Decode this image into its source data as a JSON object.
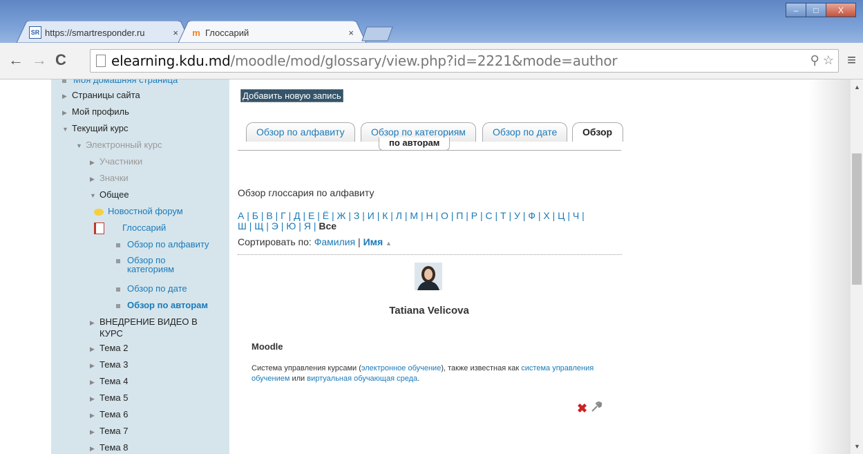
{
  "browser": {
    "tabs": [
      {
        "favicon": "SR",
        "title": "https://smartresponder.ru",
        "close": "×"
      },
      {
        "favicon": "moodle-icon",
        "title": "Глоссарий",
        "close": "×"
      }
    ],
    "url_domain": "elearning.kdu.md",
    "url_path": "/moodle/mod/glossary/view.php?id=2221&mode=author",
    "back": "←",
    "forward": "→",
    "reload": "C",
    "menu": "≡",
    "zoom_icon": "⚲",
    "star_icon": "☆",
    "window_controls": {
      "minimize": "–",
      "maximize": "□",
      "close": "X"
    }
  },
  "sidebar": {
    "items": [
      {
        "label": "Моя домашняя страница",
        "style": "blue-cut"
      },
      {
        "label": "Страницы сайта",
        "arrow": "▶"
      },
      {
        "label": "Мой профиль",
        "arrow": "▶"
      },
      {
        "label": "Текущий курс",
        "arrow": "▼"
      },
      {
        "label": "Электронный курс",
        "arrow": "▼",
        "style": "dim"
      },
      {
        "label": "Участники",
        "arrow": "▶",
        "style": "dim"
      },
      {
        "label": "Значки",
        "arrow": "▶",
        "style": "dim"
      },
      {
        "label": "Общее",
        "arrow": "▼"
      },
      {
        "label": "Новостной форум",
        "icon": "forum-icon",
        "style": "blue"
      },
      {
        "label": "Глоссарий",
        "icon": "glossary-icon",
        "style": "blue"
      },
      {
        "label": "Обзор по алфавиту",
        "style": "blue"
      },
      {
        "label": "Обзор по",
        "label2": "категориям",
        "style": "blue"
      },
      {
        "label": "Обзор по дате",
        "style": "blue"
      },
      {
        "label": "Обзор по авторам",
        "style": "blue-bold"
      },
      {
        "label": "ВНЕДРЕНИЕ ВИДЕО В",
        "label2": "КУРС",
        "arrow": "▶"
      },
      {
        "label": "Тема 2",
        "arrow": "▶"
      },
      {
        "label": "Тема 3",
        "arrow": "▶"
      },
      {
        "label": "Тема 4",
        "arrow": "▶"
      },
      {
        "label": "Тема 5",
        "arrow": "▶"
      },
      {
        "label": "Тема 6",
        "arrow": "▶"
      },
      {
        "label": "Тема 7",
        "arrow": "▶"
      },
      {
        "label": "Тема 8",
        "arrow": "▶"
      }
    ]
  },
  "content": {
    "add_entry": "Добавить новую запись",
    "tabs": [
      {
        "label": "Обзор по алфавиту"
      },
      {
        "label": "Обзор по категориям"
      },
      {
        "label": "Обзор по дате"
      },
      {
        "label": "Обзор",
        "label2": "по авторам",
        "active": true
      }
    ],
    "heading": "Обзор глоссария по алфавиту",
    "letters_line1": "А | Б | В | Г | Д | Е | Ё | Ж | З | И | К | Л | М | Н | О | П | Р | С | Т | У | Ф | Х | Ц | Ч |",
    "letters_line2": "Ш | Щ | Э | Ю | Я |",
    "letters_all": "Все",
    "sort_label": "Сортировать по:",
    "sort_surname": "Фамилия",
    "sort_sep": "|",
    "sort_name": "Имя",
    "sort_indicator": "▲",
    "author": "Tatiana Velicova",
    "entry": {
      "concept": "Moodle",
      "def_1": "Система управления курсами (",
      "link_1": "электронное обучение",
      "def_2": "), также известная как ",
      "link_2": "система управления обучением",
      "def_3": " или ",
      "link_3": "виртуальная обучающая среда",
      "def_4": "."
    },
    "delete_icon": "✖",
    "edit_icon": "🔧"
  },
  "scrollbar": {
    "up": "▲",
    "down": "▼"
  }
}
